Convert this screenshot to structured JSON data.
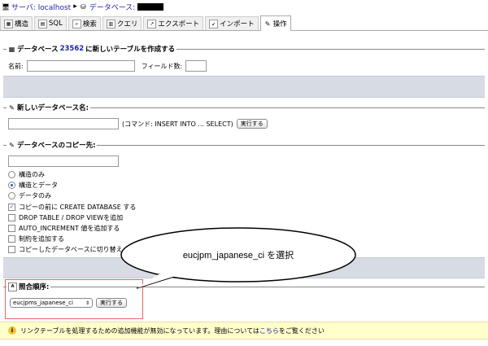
{
  "breadcrumb": {
    "server_label": "サーバ: localhost",
    "separator": "▸",
    "db_label": "データベース:"
  },
  "tabs": [
    {
      "label": "構造",
      "icon": "structure-icon"
    },
    {
      "label": "SQL",
      "icon": "sql-icon"
    },
    {
      "label": "検索",
      "icon": "search-icon"
    },
    {
      "label": "クエリ",
      "icon": "query-icon"
    },
    {
      "label": "エクスポート",
      "icon": "export-icon"
    },
    {
      "label": "インポート",
      "icon": "import-icon"
    },
    {
      "label": "操作",
      "icon": "wrench-icon"
    }
  ],
  "create_table": {
    "legend_prefix": "データベース",
    "db_id": "23562",
    "legend_suffix": "に新しいテーブルを作成する",
    "name_label": "名前:",
    "fields_label": "フィールド数:"
  },
  "rename": {
    "legend": "新しいデータベース名:",
    "hint": "(コマンド: INSERT INTO ... SELECT)",
    "button": "実行する"
  },
  "copy": {
    "legend": "データベースのコピー先:",
    "radios": [
      {
        "label": "構造のみ",
        "checked": false
      },
      {
        "label": "構造とデータ",
        "checked": true
      },
      {
        "label": "データのみ",
        "checked": false
      }
    ],
    "checks": [
      {
        "label": "コピーの前に CREATE DATABASE する",
        "checked": true
      },
      {
        "label": "DROP TABLE / DROP VIEWを追加",
        "checked": false
      },
      {
        "label": "AUTO_INCREMENT 値を追加する",
        "checked": false
      },
      {
        "label": "制約を追加する",
        "checked": false
      },
      {
        "label": "コピーしたデータベースに切り替え",
        "checked": false
      }
    ]
  },
  "collation": {
    "legend": "照合順序:",
    "selected": "eucjpms_japanese_ci",
    "button": "実行する"
  },
  "callout": {
    "text": "eucjpm_japanese_ci を選択"
  },
  "notice": {
    "text": "リンクテーブルを処理するための追加機能が無効になっています。理由については",
    "link": "こちら",
    "suffix": "をご覧ください"
  }
}
